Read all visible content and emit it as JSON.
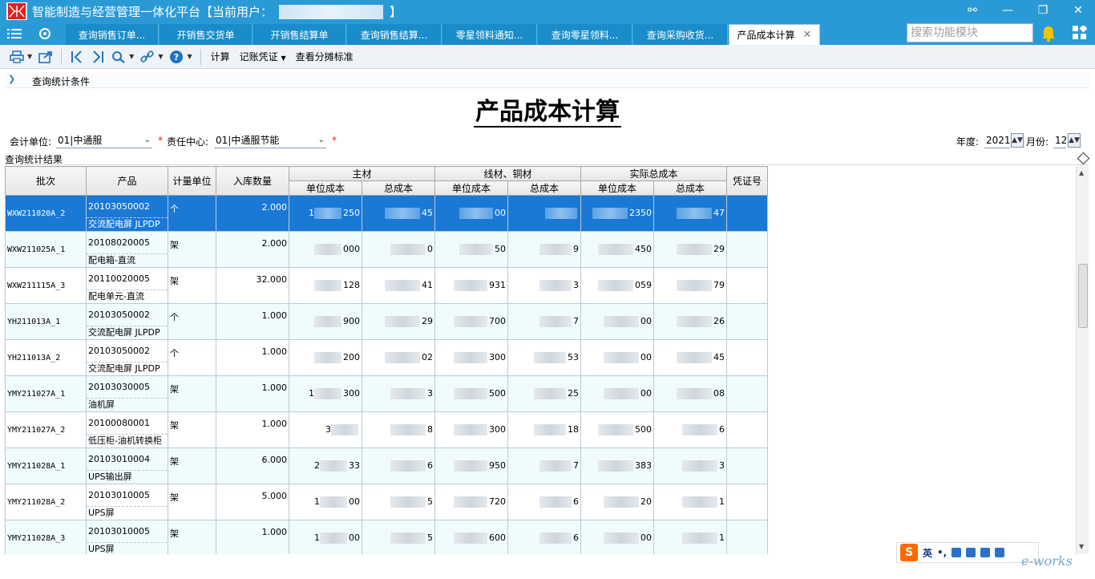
{
  "app": {
    "title": "智能制造与经营管理一体化平台【当前用户：",
    "title_end": "】"
  },
  "tabs": [
    {
      "label": "查询销售订单..."
    },
    {
      "label": "开销售交货单"
    },
    {
      "label": "开销售结算单"
    },
    {
      "label": "查询销售结算..."
    },
    {
      "label": "零星领料通知..."
    },
    {
      "label": "查询零星领料..."
    },
    {
      "label": "查询采购收货..."
    },
    {
      "label": "产品成本计算"
    }
  ],
  "search": {
    "placeholder": "搜索功能模块"
  },
  "toolbar": {
    "calc": "计算",
    "voucher": "记账凭证",
    "view_alloc": "查看分摊标准"
  },
  "condition_bar": {
    "label": "查询统计条件"
  },
  "report": {
    "title": "产品成本计算"
  },
  "filters": {
    "unit_label": "会计单位:",
    "unit_value": "01|中通服",
    "center_label": "责任中心:",
    "center_value": "01|中通服节能",
    "year_label": "年度:",
    "year_value": "2021",
    "month_label": "月份:",
    "month_value": "12"
  },
  "results_label": "查询统计结果",
  "table": {
    "headers": {
      "batch": "批次",
      "product": "产品",
      "unit": "计量单位",
      "qty": "入库数量",
      "main": "主材",
      "cable": "线材、铜材",
      "actual": "实际总成本",
      "voucher": "凭证号",
      "unit_cost": "单位成本",
      "total_cost": "总成本"
    },
    "rows": [
      {
        "batch": "WXW211020A_2",
        "code": "20103050002",
        "name": "交流配电屏 JLPDP",
        "unit": "个",
        "qty": "2.000",
        "c1a": "1",
        "c1b": "250",
        "c2b": "45",
        "c3b": "00",
        "c4b": "",
        "c5b": "2350",
        "c6b": "47"
      },
      {
        "batch": "WXW211025A_1",
        "code": "20108020005",
        "name": "配电箱-直流",
        "unit": "架",
        "qty": "2.000",
        "c1a": "",
        "c1b": "000",
        "c2b": "0",
        "c3b": "50",
        "c4b": "9",
        "c5b": "450",
        "c6b": "29"
      },
      {
        "batch": "WXW211115A_3",
        "code": "20110020005",
        "name": "配电单元-直流",
        "unit": "架",
        "qty": "32.000",
        "c1a": "",
        "c1b": "128",
        "c2b": "41",
        "c3b": "931",
        "c4b": "3",
        "c5b": "059",
        "c6b": "79"
      },
      {
        "batch": "YH211013A_1",
        "code": "20103050002",
        "name": "交流配电屏 JLPDP",
        "unit": "个",
        "qty": "1.000",
        "c1a": "",
        "c1b": "900",
        "c2b": "29",
        "c3b": "700",
        "c4b": "7",
        "c5b": "00",
        "c6b": "26"
      },
      {
        "batch": "YH211013A_2",
        "code": "20103050002",
        "name": "交流配电屏 JLPDP",
        "unit": "个",
        "qty": "1.000",
        "c1a": "",
        "c1b": "200",
        "c2b": "02",
        "c3b": "300",
        "c4b": "53",
        "c5b": "00",
        "c6b": "45"
      },
      {
        "batch": "YMY211027A_1",
        "code": "20103030005",
        "name": "油机屏",
        "unit": "架",
        "qty": "1.000",
        "c1a": "1",
        "c1b": "300",
        "c2b": "3",
        "c3b": "500",
        "c4b": "25",
        "c5b": "00",
        "c6b": "08"
      },
      {
        "batch": "YMY211027A_2",
        "code": "20100080001",
        "name": "低压柜-油机转换柜",
        "unit": "架",
        "qty": "1.000",
        "c1a": "3",
        "c1b": "",
        "c2b": "8",
        "c3b": "300",
        "c4b": "18",
        "c5b": "500",
        "c6b": "6"
      },
      {
        "batch": "YMY211028A_1",
        "code": "20103010004",
        "name": "UPS输出屏",
        "unit": "架",
        "qty": "6.000",
        "c1a": "2",
        "c1b": "33",
        "c2b": "6",
        "c3b": "950",
        "c4b": "7",
        "c5b": "383",
        "c6b": "3"
      },
      {
        "batch": "YMY211028A_2",
        "code": "20103010005",
        "name": "UPS屏",
        "unit": "架",
        "qty": "5.000",
        "c1a": "1",
        "c1b": "00",
        "c2b": "5",
        "c3b": "720",
        "c4b": "6",
        "c5b": "20",
        "c6b": "1"
      },
      {
        "batch": "YMY211028A_3",
        "code": "20103010005",
        "name": "UPS屏",
        "unit": "架",
        "qty": "1.000",
        "c1a": "1",
        "c1b": "00",
        "c2b": "5",
        "c3b": "600",
        "c4b": "6",
        "c5b": "00",
        "c6b": "1"
      }
    ]
  },
  "ime": {
    "lang": "英"
  },
  "watermark": "e-works",
  "colors": {
    "brand": "#2a9ad6",
    "selected_row": "#1a79d5",
    "alt_row": "#f0fbfc"
  }
}
